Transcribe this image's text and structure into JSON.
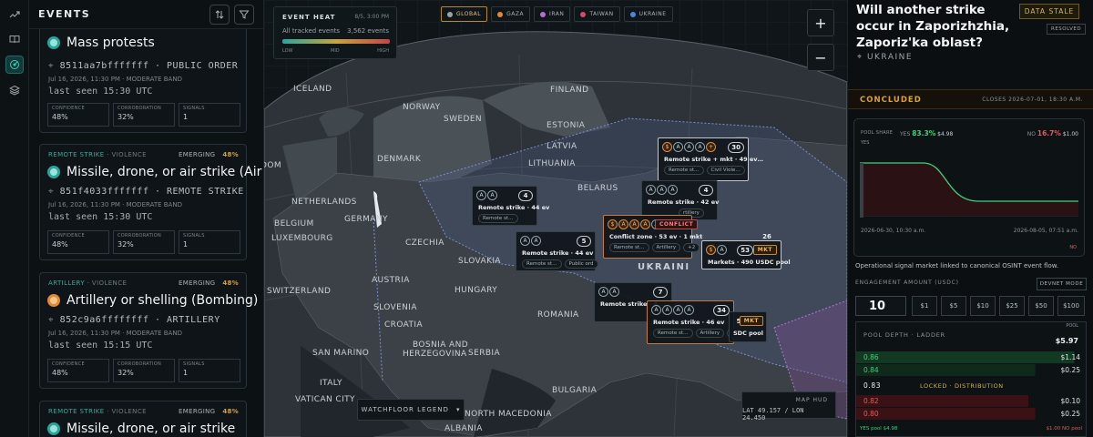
{
  "colors": {
    "accent_teal": "#2aa59a",
    "accent_gold": "#d9a13a",
    "conflict_red": "#c24747",
    "yes_green": "#3fd07e",
    "no_red": "#e45b5b",
    "data_stale": "#d9b64a"
  },
  "rail": {
    "icons": [
      "trend-icon",
      "book-icon",
      "radar-icon",
      "layers-icon"
    ]
  },
  "events": {
    "title": "EVENTS",
    "cards": [
      {
        "category": "",
        "emerging": "",
        "pct": "",
        "name": "Mass protests",
        "hash": "8511aa7bfffffff · PUBLIC ORDER",
        "date": "Jul 16, 2026, 11:30 PM · MODERATE BAND",
        "seen": "last seen 15:30 UTC",
        "conf_label": "CONFIDENCE",
        "conf": "48%",
        "corr_label": "CORROBORATION",
        "corr": "32%",
        "sig_label": "SIGNALS",
        "sig": "1",
        "dot": "#2aa59a"
      },
      {
        "category": "REMOTE STRIKE",
        "sub": " · VIOLENCE",
        "emerging": "EMERGING",
        "pct": "48%",
        "name": "Missile, drone, or air strike (Air",
        "hash": "851f4033fffffff · REMOTE STRIKE",
        "date": "Jul 16, 2026, 11:30 PM · MODERATE BAND",
        "seen": "last seen 15:30 UTC",
        "conf_label": "CONFIDENCE",
        "conf": "48%",
        "corr_label": "CORROBORATION",
        "corr": "32%",
        "sig_label": "SIGNALS",
        "sig": "1",
        "dot": "#2aa59a"
      },
      {
        "category": "ARTILLERY",
        "sub": " · VIOLENCE",
        "emerging": "EMERGING",
        "pct": "48%",
        "name": "Artillery or shelling (Bombing)",
        "hash": "852c9a6ffffffff · ARTILLERY",
        "date": "Jul 16, 2026, 11:30 PM · MODERATE BAND",
        "seen": "last seen 15:15 UTC",
        "conf_label": "CONFIDENCE",
        "conf": "48%",
        "corr_label": "CORROBORATION",
        "corr": "32%",
        "sig_label": "SIGNALS",
        "sig": "1",
        "dot": "#e08a33"
      },
      {
        "category": "REMOTE STRIKE",
        "sub": " · VIOLENCE",
        "emerging": "EMERGING",
        "pct": "48%",
        "name": "Missile, drone, or air strike",
        "dot": "#2aa59a"
      }
    ]
  },
  "map": {
    "heat": {
      "title": "EVENT HEAT",
      "time": "8/5, 3:00 PM",
      "tracked": "All tracked events",
      "count": "3,562 events",
      "low": "LOW",
      "mid": "MID",
      "high": "HIGH"
    },
    "filters": [
      {
        "label": "GLOBAL",
        "color": "#9aa3a8"
      },
      {
        "label": "GAZA",
        "color": "#e08a33"
      },
      {
        "label": "IRAN",
        "color": "#b16fd0"
      },
      {
        "label": "TAIWAN",
        "color": "#d24b6b"
      },
      {
        "label": "UKRAINE",
        "color": "#4d86d8"
      }
    ],
    "zoom_in": "+",
    "zoom_out": "−",
    "labels": {
      "iceland": "ICELAND",
      "finland": "FINLAND",
      "norway": "NORWAY",
      "sweden": "SWEDEN",
      "estonia": "ESTONIA",
      "latvia": "LATVIA",
      "denmark": "DENMARK",
      "lithuania": "LITHUANIA",
      "netherlands": "NETHERLANDS",
      "belarus": "BELARUS",
      "belgium": "BELGIUM",
      "germany": "GERMANY",
      "luxembourg": "LUXEMBOURG",
      "czechia": "CZECHIA",
      "slovakia": "SLOVAKIA",
      "ukraini": "UKRAINI",
      "austria": "AUSTRIA",
      "hungary": "HUNGARY",
      "switzerland": "SWITZERLAND",
      "slovenia": "SLOVENIA",
      "croatia": "CROATIA",
      "romania": "ROMANIA",
      "bosnia1": "BOSNIA AND",
      "bosnia2": "HERZEGOVINA",
      "serbia": "SERBIA",
      "sanmarino": "SAN MARINO",
      "italy": "ITALY",
      "vatican": "VATICAN CITY",
      "bulgaria": "BULGARIA",
      "nmacedonia": "NORTH MACEDONIA",
      "albania": "ALBANIA",
      "dom": "DOM"
    },
    "clusters": [
      {
        "count": "30",
        "text": "Remote strike + mkt · 49 ev…",
        "pills": [
          "Remote st…",
          "Civil Viole…"
        ]
      },
      {
        "count": "4",
        "text": "Remote strike · 44 ev",
        "pills": [
          "Remote st…"
        ]
      },
      {
        "count": "4",
        "text": "Remote strike · 42 ev",
        "pills": [
          "rtillery"
        ]
      },
      {
        "count": "5",
        "text": "Remote strike · 44 ev",
        "pills": [
          "Remote st…",
          "Public ord"
        ]
      },
      {
        "tag": "CONFLICT",
        "text": "Conflict zone · 53 ev · 1 mkt",
        "pills": [
          "Remote st…",
          "Artillery",
          "+2"
        ]
      },
      {
        "count": "26"
      },
      {
        "count": "53",
        "tag": "MKT",
        "text": "Markets · 490 USDC pool"
      },
      {
        "count": "7",
        "text": "Remote strike · 4…"
      },
      {
        "count": "34",
        "text": "Remote strike · 46 ev",
        "pills": [
          "Remote st…",
          "Artillery",
          "+2"
        ]
      },
      {
        "count": "5",
        "tag": "MKT",
        "text": "SDC pool"
      }
    ],
    "legend": "WATCHFLOOR LEGEND",
    "hud_title": "MAP HUD",
    "hud_coords": "LAT 49.157 / LON 24.450"
  },
  "market": {
    "question": "Will another strike occur in Zaporizhzhia, Zaporiz'ka oblast?",
    "stale": "DATA STALE",
    "resolved": "RESOLVED",
    "location": "UKRAINE",
    "status": "CONCLUDED",
    "closes": "CLOSES 2026-07-01, 18:30 A.M.",
    "pool_share_label": "POOL SHARE",
    "yes_label": "YES",
    "yes_pct": "83.3%",
    "yes_amt": "$4.98",
    "no_label": "NO",
    "no_pct": "16.7%",
    "no_amt": "$1.00",
    "chart_yes": "YES",
    "chart_no": "NO",
    "date_start": "2026-06-30, 10:30 a.m.",
    "date_end": "2026-08-05, 07:51 a.m.",
    "desc": "Operational signal market linked to canonical OSINT event flow.",
    "engagement_label": "ENGAGEMENT AMOUNT (USDC)",
    "devnet": "DEVNET MODE",
    "amount": "10",
    "quick": [
      "$1",
      "$5",
      "$10",
      "$25",
      "$50",
      "$100"
    ],
    "depth": {
      "title": "POOL DEPTH · LADDER",
      "pool_label": "POOL",
      "pool_value": "$5.97",
      "yes_rows": [
        {
          "p": "0.86",
          "v": "$1.14",
          "fill": 0.6
        },
        {
          "p": "0.84",
          "v": "$0.25",
          "fill": 0.2
        }
      ],
      "lock": "LOCKED · DISTRIBUTION",
      "lock_price": "0.83",
      "no_rows": [
        {
          "p": "0.82",
          "v": "$0.10",
          "fill": 0.05
        },
        {
          "p": "0.80",
          "v": "$0.25",
          "fill": 0.2
        }
      ],
      "foot_yes": "YES pool $4.98",
      "foot_no": "$1.00 NO pool"
    }
  }
}
